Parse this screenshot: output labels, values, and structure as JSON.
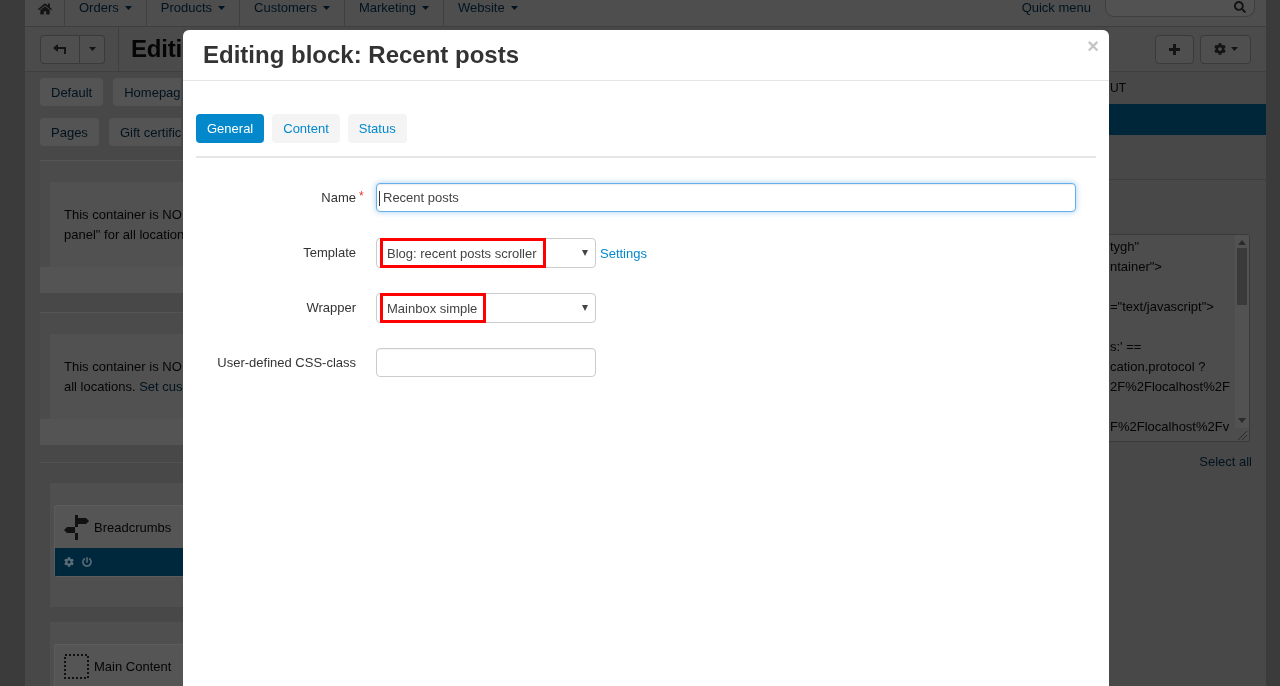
{
  "nav": {
    "items": [
      {
        "label": "Orders"
      },
      {
        "label": "Products"
      },
      {
        "label": "Customers"
      },
      {
        "label": "Marketing"
      },
      {
        "label": "Website"
      }
    ],
    "quick_menu": "Quick menu"
  },
  "toolbar": {
    "title": "Editi"
  },
  "location_tabs": [
    [
      {
        "label": "Default",
        "selected": false
      },
      {
        "label": "Homepag",
        "selected": false
      }
    ],
    [
      {
        "label": "Pages",
        "selected": false
      },
      {
        "label": "Gift certific",
        "selected": false
      }
    ]
  ],
  "containers": [
    {
      "lines": [
        "This container is NO",
        "panel\" for all location"
      ]
    },
    {
      "lines": [
        "This container is NO",
        "all locations."
      ],
      "link": "Set cus"
    }
  ],
  "blocks": [
    {
      "kind": "breadcrumbs",
      "name": "Breadcrumbs",
      "toolbar": true
    },
    {
      "kind": "main_content",
      "name": "Main Content"
    }
  ],
  "sidebar": {
    "heading": "UT",
    "code": "tygh\"\nntainer\">\n\n=\"text/javascript\">\n\ns:' ==\ncation.protocol ?\n2F%2Flocalhost%2F\n\nF%2Flocalhost%2Fv",
    "select_all": "Select all"
  },
  "modal": {
    "title": "Editing block: Recent posts",
    "close": "×",
    "tabs": [
      {
        "label": "General",
        "selected": true
      },
      {
        "label": "Content",
        "selected": false
      },
      {
        "label": "Status",
        "selected": false
      }
    ],
    "fields": [
      {
        "kind": "wide_input",
        "label": "Name",
        "required_mark": "*",
        "value": "Recent posts",
        "focused": true
      },
      {
        "kind": "select",
        "label": "Template",
        "value": "Blog: recent posts scroller",
        "highlighted": true,
        "link": "Settings"
      },
      {
        "kind": "select",
        "label": "Wrapper",
        "value": "Mainbox simple",
        "highlighted": true
      },
      {
        "kind": "input",
        "label": "User-defined CSS-class",
        "focused": false
      }
    ]
  }
}
